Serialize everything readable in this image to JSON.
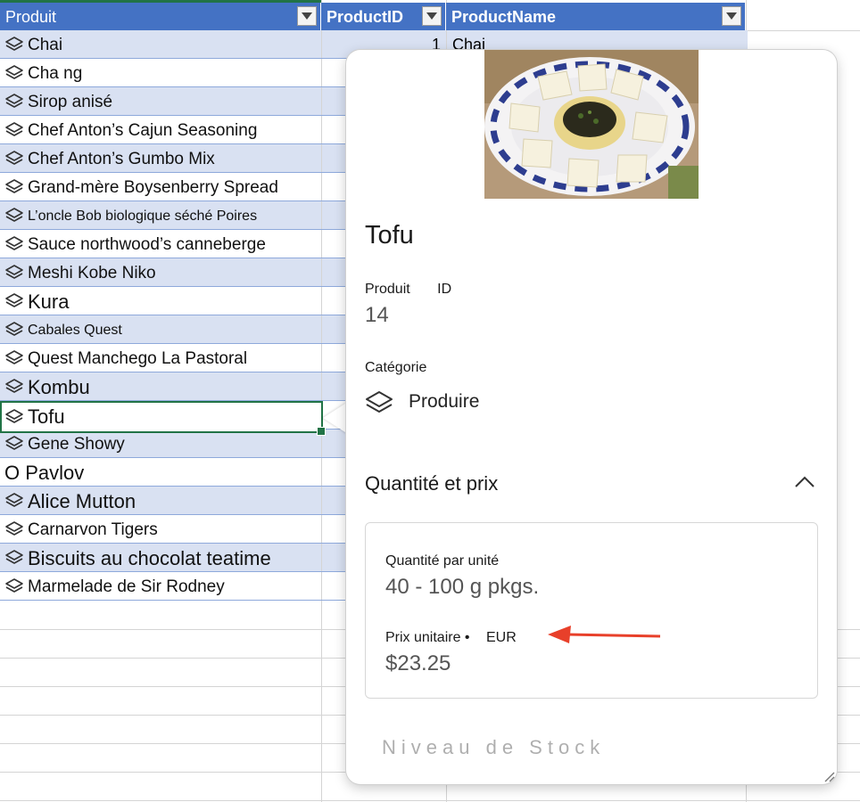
{
  "sheet": {
    "headers": [
      {
        "label": "Produit",
        "bold": false
      },
      {
        "label": "ProductID",
        "bold": true
      },
      {
        "label": "ProductName",
        "bold": true
      }
    ],
    "first_row": {
      "id": "1",
      "name": "Chai"
    },
    "rows": [
      {
        "label": "Chai",
        "icon": true,
        "style": "normal"
      },
      {
        "label": "Cha ng",
        "icon": true,
        "style": "normal"
      },
      {
        "label": "Sirop anisé",
        "icon": true,
        "style": "normal"
      },
      {
        "label": "Chef Anton’s Cajun Seasoning",
        "icon": true,
        "style": "normal"
      },
      {
        "label": "Chef Anton’s Gumbo Mix",
        "icon": true,
        "style": "normal"
      },
      {
        "label": "Grand-mère Boysenberry Spread",
        "icon": true,
        "style": "normal"
      },
      {
        "label": "L’oncle Bob biologique séché     Poires",
        "icon": true,
        "style": "small"
      },
      {
        "label": "Sauce northwood’s canneberge",
        "icon": true,
        "style": "normal"
      },
      {
        "label": "Meshi  Kobe Niko",
        "icon": true,
        "style": "normal"
      },
      {
        "label": "Kura",
        "icon": true,
        "style": "big"
      },
      {
        "label": "Cabales Quest",
        "icon": true,
        "style": "small"
      },
      {
        "label": "Quest Manchego La    Pastoral",
        "icon": true,
        "style": "normal"
      },
      {
        "label": "Kombu",
        "icon": true,
        "style": "big"
      },
      {
        "label": "Tofu",
        "icon": true,
        "style": "big"
      },
      {
        "label": "Gene Showy",
        "icon": true,
        "style": "normal"
      },
      {
        "label": "O Pavlov",
        "icon": false,
        "style": "big"
      },
      {
        "label": "Alice Mutton",
        "icon": true,
        "style": "big"
      },
      {
        "label": "Carnarvon Tigers",
        "icon": true,
        "style": "normal"
      },
      {
        "label": "Biscuits au chocolat teatime",
        "icon": true,
        "style": "big"
      },
      {
        "label": "Marmelade de Sir Rodney",
        "icon": true,
        "style": "normal"
      }
    ],
    "selected_row": "Tofu",
    "colors": {
      "header": "#4472c4",
      "band": "#d9e1f2",
      "selection": "#217346"
    }
  },
  "card": {
    "title": "Tofu",
    "product_id_label": "Produit",
    "product_id_label_suffix": "ID",
    "product_id_value": "14",
    "category_label": "Catégorie",
    "category_value": "Produire",
    "section_title": "Quantité et prix",
    "quantity_label": "Quantité par unité",
    "quantity_value": "40 - 100 g pkgs.",
    "price_label": "Prix unitaire •",
    "price_currency": "EUR",
    "price_value": "$23.25",
    "cut_off_text": "Niveau de Stock",
    "image_icon": "tofu-dish-photo",
    "arrow_color": "#e8402a"
  }
}
